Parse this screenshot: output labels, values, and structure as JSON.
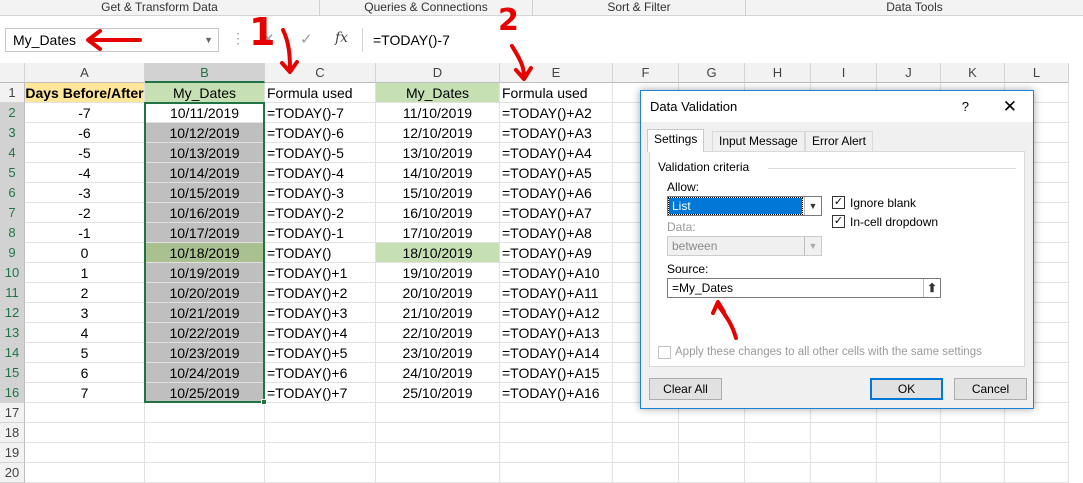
{
  "ribbon": {
    "groups": [
      "Get & Transform Data",
      "Queries & Connections",
      "Sort & Filter",
      "Data Tools"
    ]
  },
  "formula_bar": {
    "name_box": "My_Dates",
    "cancel_glyph": "✕",
    "enter_glyph": "✓",
    "fx_label": "fx",
    "formula": "=TODAY()-7"
  },
  "columns": [
    "A",
    "B",
    "C",
    "D",
    "E",
    "F",
    "G",
    "H",
    "I",
    "J",
    "K",
    "L"
  ],
  "rows": [
    "1",
    "2",
    "3",
    "4",
    "5",
    "6",
    "7",
    "8",
    "9",
    "10",
    "11",
    "12",
    "13",
    "14",
    "15",
    "16",
    "17",
    "18",
    "19",
    "20"
  ],
  "sheet": {
    "headers": [
      "Days Before/After",
      "My_Dates",
      "Formula used",
      "My_Dates",
      "Formula used"
    ],
    "data": [
      [
        "-7",
        "10/11/2019",
        "=TODAY()-7",
        "11/10/2019",
        "=TODAY()+A2"
      ],
      [
        "-6",
        "10/12/2019",
        "=TODAY()-6",
        "12/10/2019",
        "=TODAY()+A3"
      ],
      [
        "-5",
        "10/13/2019",
        "=TODAY()-5",
        "13/10/2019",
        "=TODAY()+A4"
      ],
      [
        "-4",
        "10/14/2019",
        "=TODAY()-4",
        "14/10/2019",
        "=TODAY()+A5"
      ],
      [
        "-3",
        "10/15/2019",
        "=TODAY()-3",
        "15/10/2019",
        "=TODAY()+A6"
      ],
      [
        "-2",
        "10/16/2019",
        "=TODAY()-2",
        "16/10/2019",
        "=TODAY()+A7"
      ],
      [
        "-1",
        "10/17/2019",
        "=TODAY()-1",
        "17/10/2019",
        "=TODAY()+A8"
      ],
      [
        "0",
        "10/18/2019",
        "=TODAY()",
        "18/10/2019",
        "=TODAY()+A9"
      ],
      [
        "1",
        "10/19/2019",
        "=TODAY()+1",
        "19/10/2019",
        "=TODAY()+A10"
      ],
      [
        "2",
        "10/20/2019",
        "=TODAY()+2",
        "20/10/2019",
        "=TODAY()+A11"
      ],
      [
        "3",
        "10/21/2019",
        "=TODAY()+3",
        "21/10/2019",
        "=TODAY()+A12"
      ],
      [
        "4",
        "10/22/2019",
        "=TODAY()+4",
        "22/10/2019",
        "=TODAY()+A13"
      ],
      [
        "5",
        "10/23/2019",
        "=TODAY()+5",
        "23/10/2019",
        "=TODAY()+A14"
      ],
      [
        "6",
        "10/24/2019",
        "=TODAY()+6",
        "24/10/2019",
        "=TODAY()+A15"
      ],
      [
        "7",
        "10/25/2019",
        "=TODAY()+7",
        "25/10/2019",
        "=TODAY()+A16"
      ]
    ]
  },
  "dialog": {
    "title": "Data Validation",
    "help": "?",
    "close": "✕",
    "tabs": [
      "Settings",
      "Input Message",
      "Error Alert"
    ],
    "criteria_label": "Validation criteria",
    "allow_label": "Allow:",
    "allow_value": "List",
    "ignore_blank": "Ignore blank",
    "in_cell_dropdown": "In-cell dropdown",
    "data_label": "Data:",
    "data_value": "between",
    "source_label": "Source:",
    "source_value": "=My_Dates",
    "apply_all": "Apply these changes to all other cells with the same settings",
    "clear_all": "Clear All",
    "ok": "OK",
    "cancel": "Cancel"
  },
  "annotations": {
    "one": "1",
    "two": "2"
  },
  "colors": {
    "header_yellow": "#ffe699",
    "header_green": "#c6e0b4",
    "selection_gray": "#bfbfbf",
    "selection_dark": "#a9c091",
    "excel_green": "#217346",
    "annotation_red": "#e60000",
    "dialog_border": "#1883d7",
    "list_highlight": "#0078d7"
  }
}
